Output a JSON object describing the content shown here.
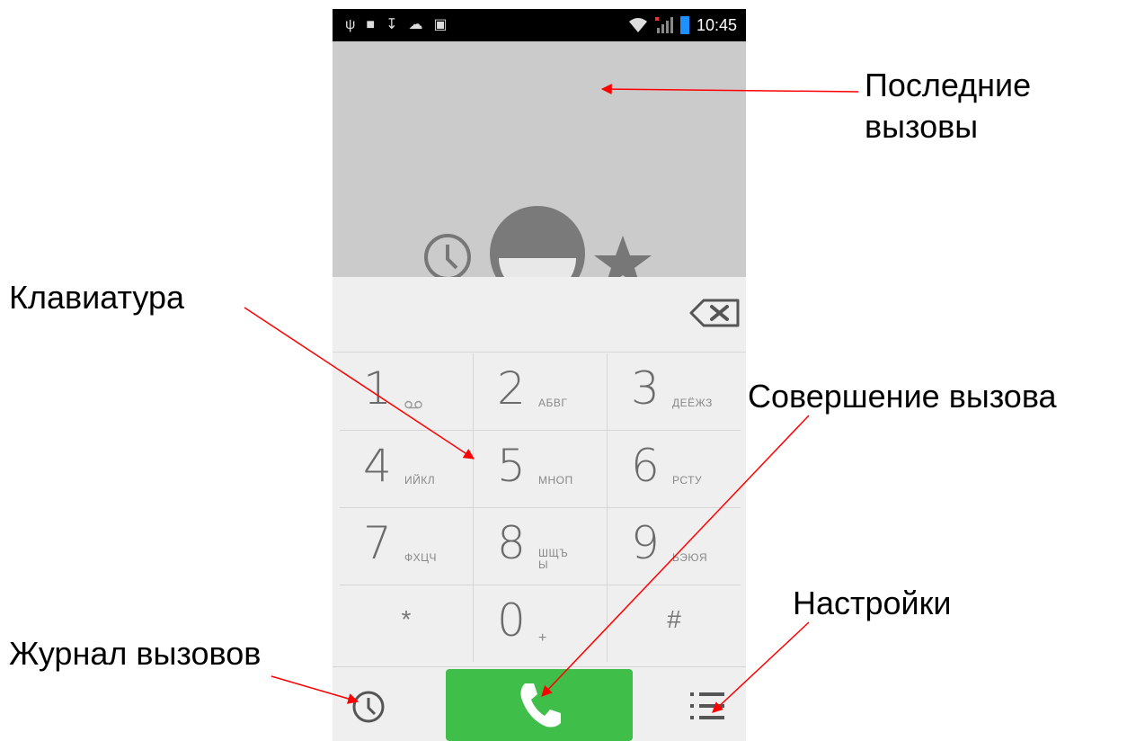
{
  "statusbar": {
    "time": "10:45",
    "left_icons": [
      "usb-icon",
      "lock-icon",
      "download-icon",
      "cloud-upload-icon",
      "image-icon"
    ],
    "right_icons": [
      "wifi-icon",
      "no-signal-icon",
      "battery-icon"
    ]
  },
  "keypad": {
    "keys": [
      {
        "num": "1",
        "letters": "",
        "icon": "voicemail-icon"
      },
      {
        "num": "2",
        "letters": "АБВГ"
      },
      {
        "num": "3",
        "letters": "ДЕЁЖЗ"
      },
      {
        "num": "4",
        "letters": "ИЙКЛ"
      },
      {
        "num": "5",
        "letters": "МНОП"
      },
      {
        "num": "6",
        "letters": "РСТУ"
      },
      {
        "num": "7",
        "letters": "ФХЦЧ"
      },
      {
        "num": "8",
        "letters": "ШЩЪ Ы"
      },
      {
        "num": "9",
        "letters": "ЬЭЮЯ"
      },
      {
        "num": "*",
        "letters": ""
      },
      {
        "num": "0",
        "letters": "+"
      },
      {
        "num": "#",
        "letters": ""
      }
    ]
  },
  "annotations": {
    "recent_calls": "Последние вызовы",
    "keypad": "Клавиатура",
    "make_call": "Совершение вызова",
    "settings": "Настройки",
    "call_log": "Журнал вызовов"
  },
  "colors": {
    "call_button": "#3fbf4a",
    "arrow": "#ff0000",
    "recent_background": "#cbcbcb"
  }
}
